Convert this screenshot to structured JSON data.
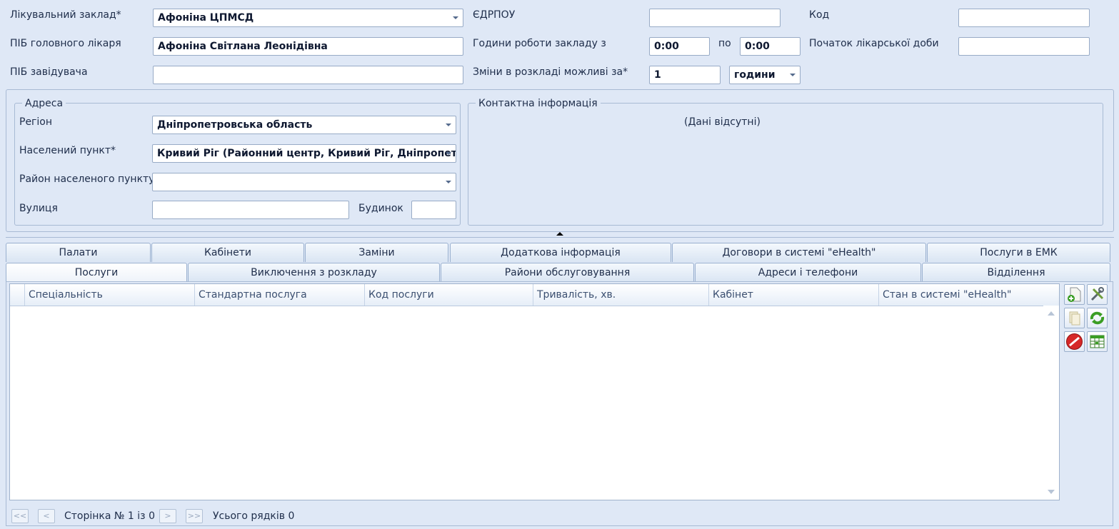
{
  "form": {
    "facility_label": "Лікувальний заклад*",
    "facility_value": "Афоніна ЦПМСД",
    "edrpou_label": "ЄДРПОУ",
    "edrpou_value": "",
    "code_label": "Код",
    "code_value": "",
    "chief_label": "ПІБ головного лікаря",
    "chief_value": "Афоніна Світлана Леонідівна",
    "hours_label": "Години роботи закладу з",
    "hours_from": "0:00",
    "hours_to_label": "по",
    "hours_to": "0:00",
    "day_start_label": "Початок лікарської доби",
    "day_start_value": "",
    "head_label": "ПІБ завідувача",
    "head_value": "",
    "changes_label": "Зміни в розкладі можливі за*",
    "changes_value": "1",
    "changes_unit": "години"
  },
  "address": {
    "legend": "Адреса",
    "region_label": "Регіон",
    "region_value": "Дніпропетровська область",
    "settlement_label": "Населений пункт*",
    "settlement_value": "Кривий Ріг (Районний центр, Кривий Ріг, Дніпропетровська область)",
    "district_label": "Район населеного пункту",
    "district_value": "",
    "street_label": "Вулиця",
    "street_value": "",
    "building_label": "Будинок",
    "building_value": ""
  },
  "contact": {
    "legend": "Контактна інформація",
    "empty_text": "(Дані відсутні)"
  },
  "tabs_row1": [
    "Палати",
    "Кабінети",
    "Заміни",
    "Додаткова інформація",
    "Договори в системі \"eHealth\"",
    "Послуги в ЕМК"
  ],
  "tabs_row2": [
    "Послуги",
    "Виключення з розкладу",
    "Райони обслуговування",
    "Адреси і телефони",
    "Відділення"
  ],
  "active_tab": "Послуги",
  "grid": {
    "columns": [
      "Спеціальність",
      "Стандартна послуга",
      "Код послуги",
      "Тривалість, хв.",
      "Кабінет",
      "Стан в системі \"eHealth\""
    ]
  },
  "toolbar": {
    "icons": [
      "add-document-icon",
      "edit-tools-icon",
      "copy-icon",
      "refresh-icon",
      "delete-icon",
      "export-excel-icon"
    ]
  },
  "pager": {
    "first": "<<",
    "prev": "<",
    "page_text": "Сторінка № 1 із 0",
    "next": ">",
    "last": ">>",
    "total_text": "Усього рядків 0"
  },
  "colors": {
    "background": "#dfe8f6",
    "border": "#98abc6",
    "delete_red": "#d62828",
    "action_green": "#3a9d23"
  }
}
